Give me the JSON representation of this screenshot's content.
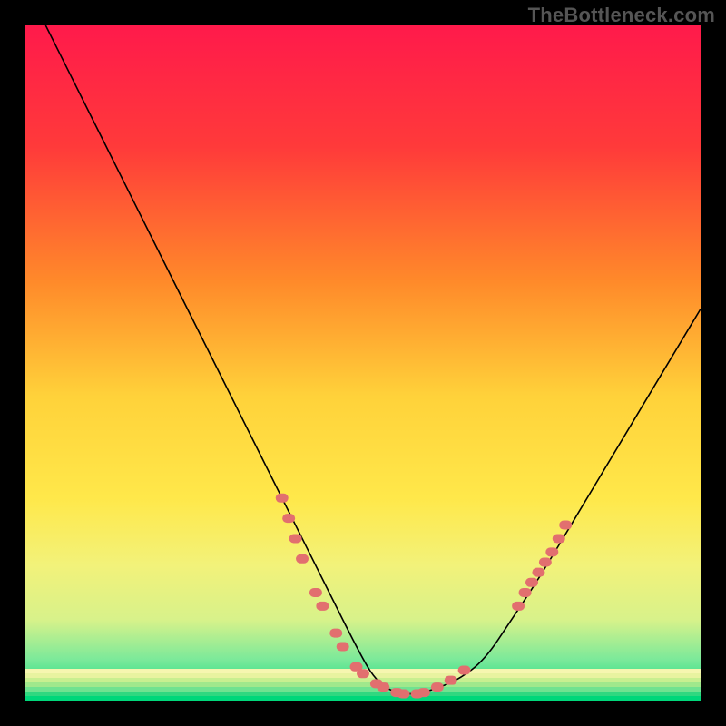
{
  "watermark": "TheBottleneck.com",
  "chart_data": {
    "type": "line",
    "title": "",
    "xlabel": "",
    "ylabel": "",
    "xlim": [
      0,
      100
    ],
    "ylim": [
      0,
      100
    ],
    "grid": false,
    "background_gradient": {
      "stops": [
        {
          "offset": 0,
          "color": "#ff1a4b"
        },
        {
          "offset": 18,
          "color": "#ff3a3a"
        },
        {
          "offset": 38,
          "color": "#ff8a2a"
        },
        {
          "offset": 55,
          "color": "#ffd23a"
        },
        {
          "offset": 70,
          "color": "#ffe84a"
        },
        {
          "offset": 80,
          "color": "#f2f27a"
        },
        {
          "offset": 88,
          "color": "#d8f28a"
        },
        {
          "offset": 94,
          "color": "#7ae99a"
        },
        {
          "offset": 100,
          "color": "#00d77a"
        }
      ]
    },
    "series": [
      {
        "name": "bottleneck-curve",
        "x": [
          3,
          8,
          14,
          20,
          26,
          32,
          38,
          44,
          50,
          52,
          54,
          56,
          58,
          60,
          64,
          68,
          72,
          76,
          82,
          88,
          94,
          100
        ],
        "y": [
          100,
          90,
          78,
          66,
          54,
          42,
          30,
          18,
          6,
          3,
          1.5,
          1,
          1,
          1.5,
          3,
          6,
          12,
          18,
          28,
          38,
          48,
          58
        ]
      }
    ],
    "markers": {
      "name": "highlight-dots",
      "color": "#e26f6f",
      "points": [
        {
          "x": 38,
          "y": 30
        },
        {
          "x": 39,
          "y": 27
        },
        {
          "x": 40,
          "y": 24
        },
        {
          "x": 41,
          "y": 21
        },
        {
          "x": 43,
          "y": 16
        },
        {
          "x": 44,
          "y": 14
        },
        {
          "x": 46,
          "y": 10
        },
        {
          "x": 47,
          "y": 8
        },
        {
          "x": 49,
          "y": 5
        },
        {
          "x": 50,
          "y": 4
        },
        {
          "x": 52,
          "y": 2.5
        },
        {
          "x": 53,
          "y": 2
        },
        {
          "x": 55,
          "y": 1.2
        },
        {
          "x": 56,
          "y": 1
        },
        {
          "x": 58,
          "y": 1
        },
        {
          "x": 59,
          "y": 1.2
        },
        {
          "x": 61,
          "y": 2
        },
        {
          "x": 63,
          "y": 3
        },
        {
          "x": 65,
          "y": 4.5
        },
        {
          "x": 73,
          "y": 14
        },
        {
          "x": 74,
          "y": 16
        },
        {
          "x": 75,
          "y": 17.5
        },
        {
          "x": 76,
          "y": 19
        },
        {
          "x": 77,
          "y": 20.5
        },
        {
          "x": 78,
          "y": 22
        },
        {
          "x": 79,
          "y": 24
        },
        {
          "x": 80,
          "y": 26
        }
      ]
    }
  }
}
